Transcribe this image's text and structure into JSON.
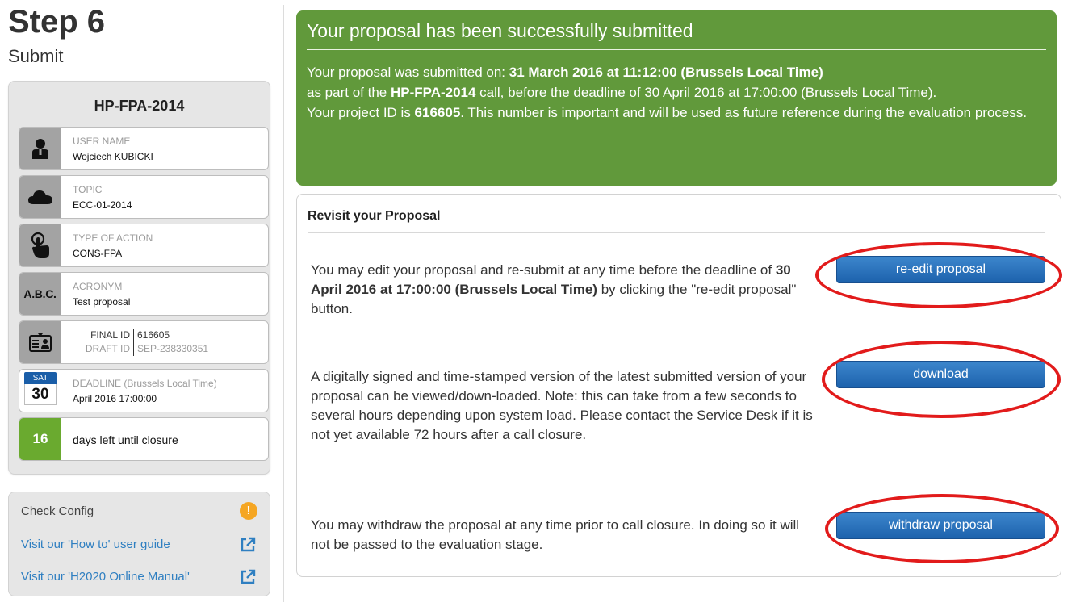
{
  "step": {
    "title": "Step 6",
    "subtitle": "Submit"
  },
  "sidebar": {
    "call_id": "HP-FPA-2014",
    "user": {
      "label": "USER NAME",
      "value": "Wojciech KUBICKI"
    },
    "topic": {
      "label": "TOPIC",
      "value": "ECC-01-2014"
    },
    "action": {
      "label": "TYPE OF ACTION",
      "value": "CONS-FPA"
    },
    "acronym": {
      "icon_text": "A.B.C.",
      "label": "ACRONYM",
      "value": "Test proposal"
    },
    "ids": {
      "final_label": "FINAL ID",
      "final_value": "616605",
      "draft_label": "DRAFT ID",
      "draft_value": "SEP-238330351"
    },
    "deadline": {
      "day_abbr": "SAT",
      "day_num": "30",
      "label": "DEADLINE (Brussels Local Time)",
      "value": "April 2016 17:00:00"
    },
    "days_left": {
      "count": "16",
      "text": "days left until closure"
    }
  },
  "links": {
    "check_config": "Check Config",
    "warn_icon": "!",
    "howto": "Visit our 'How to' user guide",
    "manual": "Visit our 'H2020 Online Manual'"
  },
  "success": {
    "title": "Your proposal has been successfully submitted",
    "l1_pre": "Your proposal was submitted on: ",
    "l1_bold": "31 March 2016 at 11:12:00 (Brussels Local Time)",
    "l2_pre": "as part of the ",
    "l2_bold": "HP-FPA-2014",
    "l2_post": " call, before the deadline of 30 April 2016 at 17:00:00 (Brussels Local Time).",
    "l3_pre": "Your project ID is ",
    "l3_bold": "616605",
    "l3_post": ". This number is important and will be used as future reference during the evaluation process."
  },
  "revisit": {
    "title": "Revisit your Proposal",
    "reedit_pre": "You may edit your proposal and re-submit at any time before the deadline of ",
    "reedit_bold": "30 April 2016 at 17:00:00 (Brussels Local Time)",
    "reedit_post": " by clicking the \"re-edit proposal\" button.",
    "reedit_button": "re-edit proposal",
    "download_text": "A digitally signed and time-stamped version of the latest submitted version of your proposal can be viewed/down-loaded. Note: this can take from a few seconds to several hours depending upon system load. Please contact the Service Desk if it is not yet available 72 hours after a call closure.",
    "download_button": "download",
    "withdraw_text": "You may withdraw the proposal at any time prior to call closure. In doing so it will not be passed to the evaluation stage.",
    "withdraw_button": "withdraw proposal"
  },
  "colors": {
    "success_green": "#61993b",
    "button_blue": "#2a73bf",
    "annotation_red": "#e21b1b",
    "days_green": "#6aaa2f",
    "link_blue": "#2f7fc1"
  }
}
